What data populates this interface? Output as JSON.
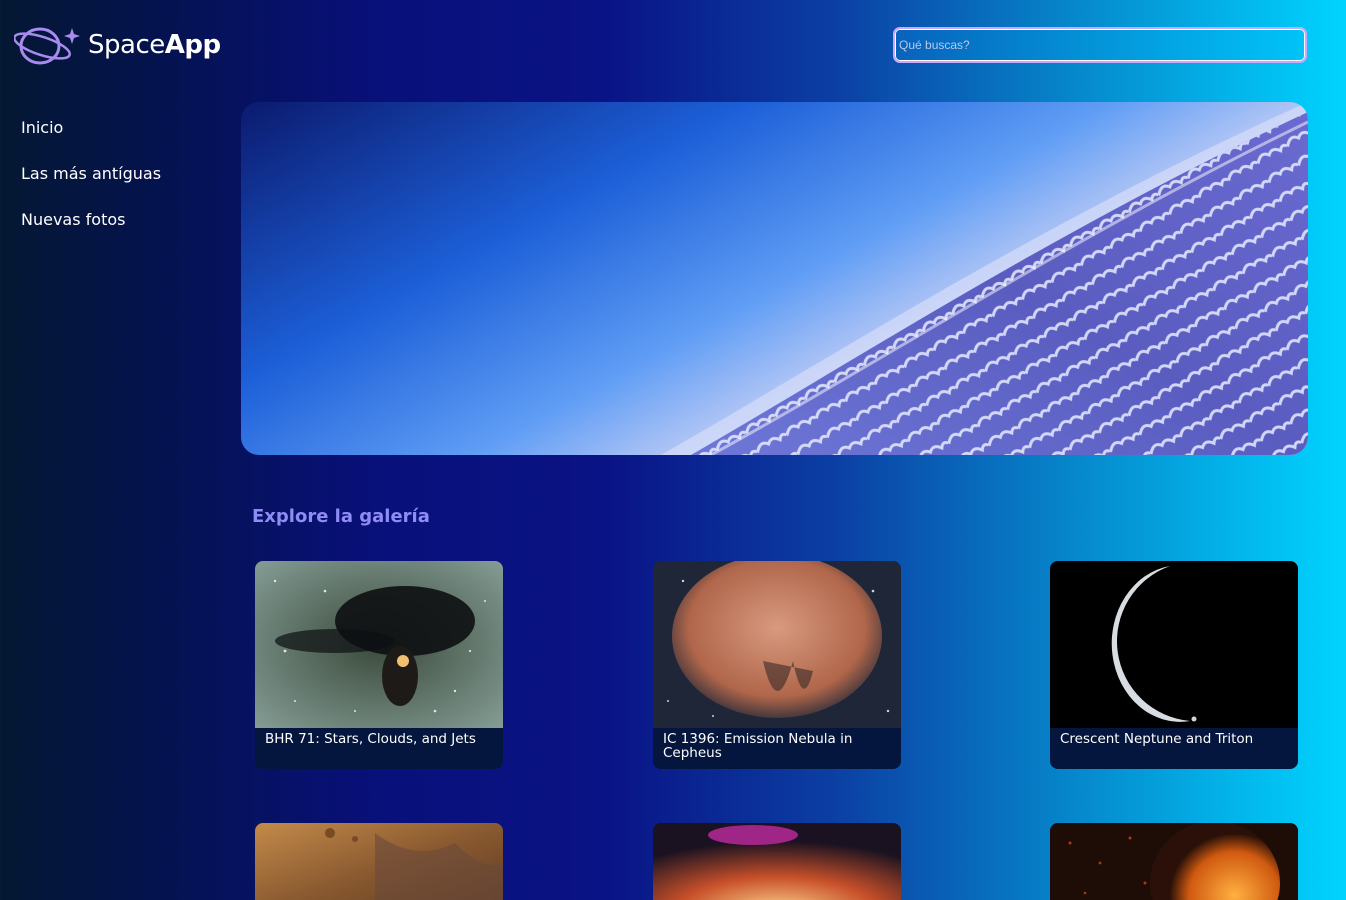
{
  "header": {
    "logo": {
      "light": "Space",
      "bold": "App"
    },
    "search": {
      "placeholder": "Qué buscas?",
      "value": ""
    }
  },
  "sidebar": {
    "items": [
      {
        "label": "Inicio"
      },
      {
        "label": "Las más antíguas"
      },
      {
        "label": "Nuevas fotos"
      }
    ]
  },
  "gallery": {
    "title": "Explore la galería",
    "cards": [
      {
        "caption": "BHR 71: Stars, Clouds, and Jets"
      },
      {
        "caption": "IC 1396: Emission Nebula in Cepheus"
      },
      {
        "caption": "Crescent Neptune and Triton"
      },
      {
        "caption": ""
      },
      {
        "caption": ""
      },
      {
        "caption": ""
      }
    ]
  },
  "colors": {
    "accent": "#8f8cf5",
    "search_border": "#c9a9ff",
    "card_bg": "#04163d"
  }
}
